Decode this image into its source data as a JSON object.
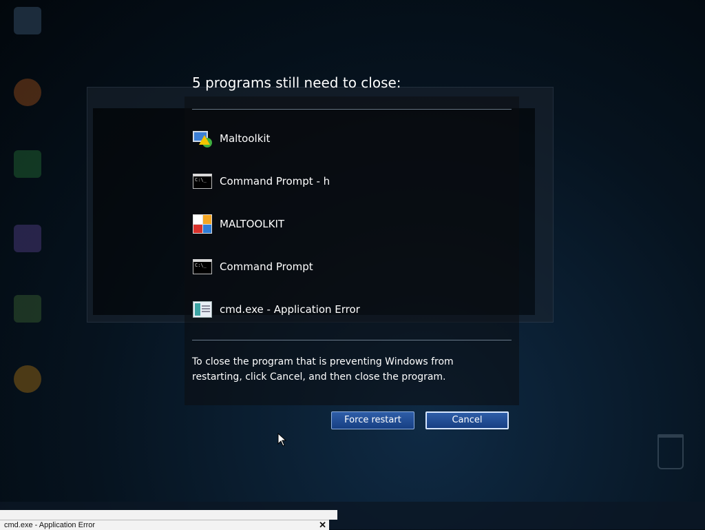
{
  "overlay": {
    "heading": "5 programs still need to close:",
    "programs": [
      {
        "label": "Maltoolkit",
        "icon": "maltoolkit-warning-icon"
      },
      {
        "label": "Command Prompt - h",
        "icon": "command-prompt-icon"
      },
      {
        "label": "MALTOOLKIT",
        "icon": "maltoolkit-tiles-icon"
      },
      {
        "label": "Command Prompt",
        "icon": "command-prompt-icon"
      },
      {
        "label": "cmd.exe - Application Error",
        "icon": "application-error-icon"
      }
    ],
    "message": "To close the program that is preventing Windows from restarting, click Cancel, and then close the program.",
    "buttons": {
      "force_restart": "Force restart",
      "cancel": "Cancel"
    }
  },
  "taskbar": {
    "popup_title": "cmd.exe - Application Error",
    "close_glyph": "✕"
  },
  "cmd_icon_text": "C:\\_"
}
